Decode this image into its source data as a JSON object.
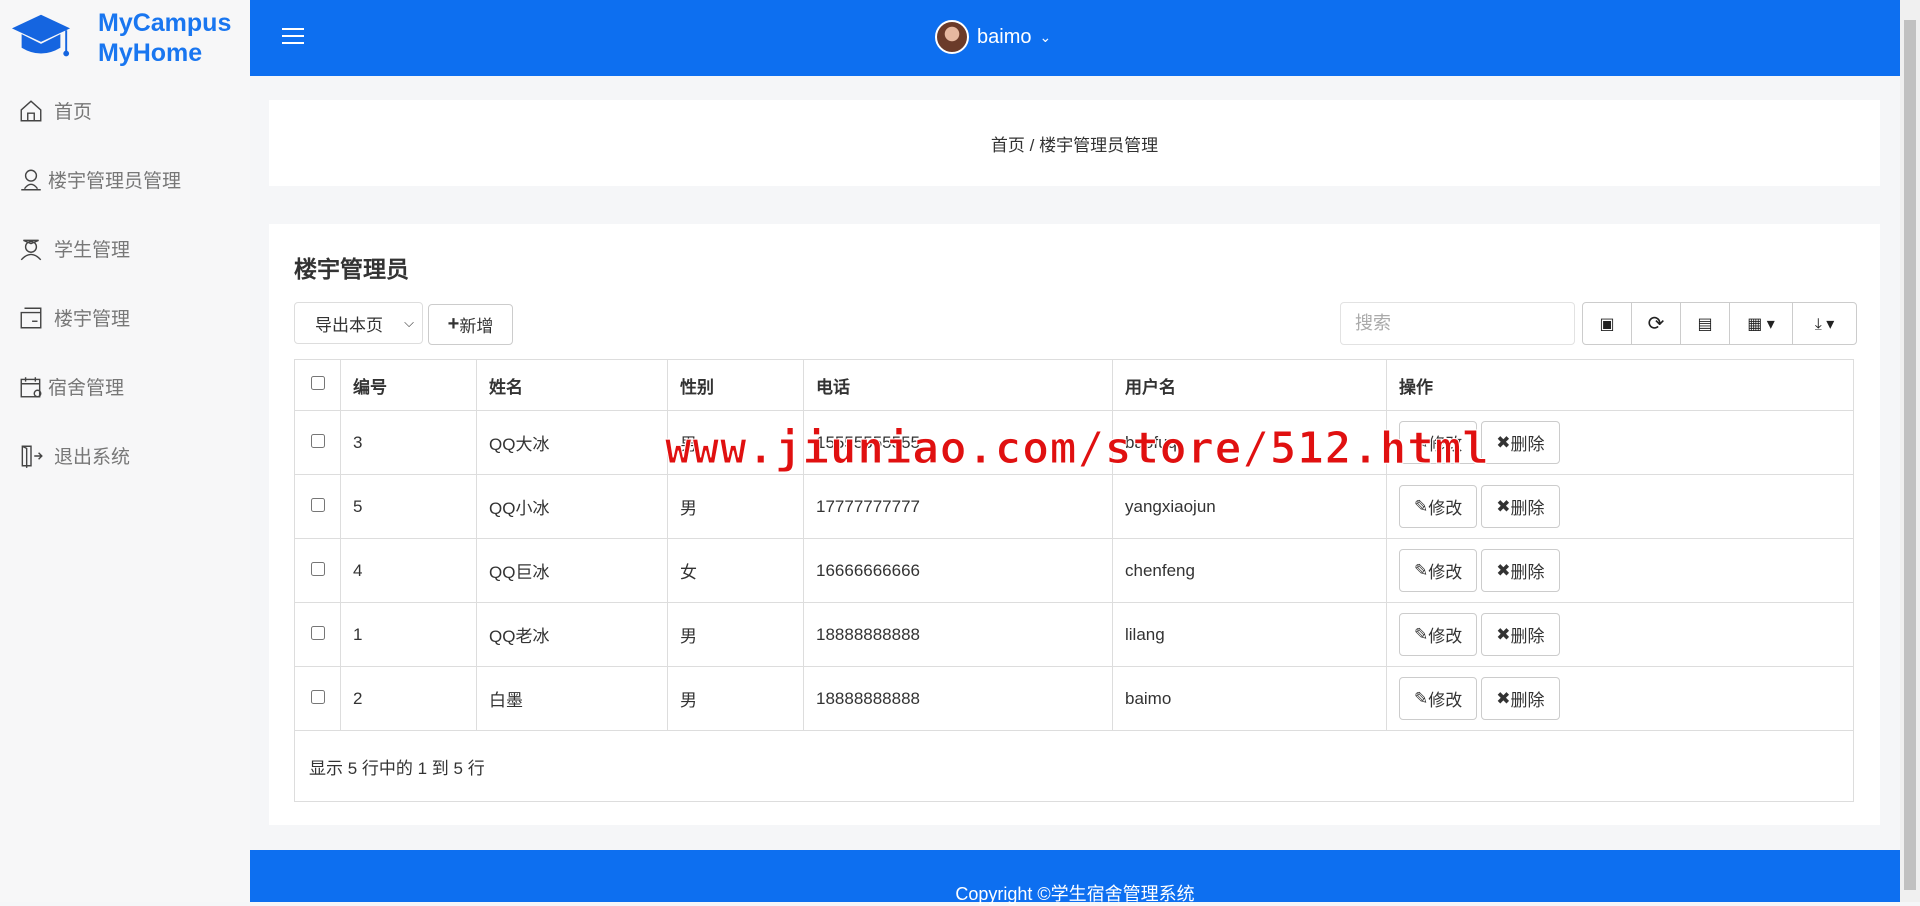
{
  "brand": {
    "line1": "MyCampus",
    "line2": "MyHome"
  },
  "sidebar": {
    "items": [
      {
        "label": "首页",
        "icon": "home-icon"
      },
      {
        "label": "楼宇管理员管理",
        "icon": "admin-icon"
      },
      {
        "label": "学生管理",
        "icon": "student-icon"
      },
      {
        "label": "楼宇管理",
        "icon": "folder-icon"
      },
      {
        "label": "宿舍管理",
        "icon": "calendar-icon"
      },
      {
        "label": "退出系统",
        "icon": "logout-icon"
      }
    ]
  },
  "header": {
    "username": "baimo"
  },
  "breadcrumb": "首页 / 楼宇管理员管理",
  "main": {
    "title": "楼宇管理员",
    "export_select": "导出本页",
    "add_label": "新增",
    "search_placeholder": "搜索"
  },
  "table": {
    "headers": [
      "编号",
      "姓名",
      "性别",
      "电话",
      "用户名",
      "操作"
    ],
    "rows": [
      [
        "3",
        "QQ大冰",
        "男",
        "15555555555",
        "baofuq"
      ],
      [
        "5",
        "QQ小冰",
        "男",
        "17777777777",
        "yangxiaojun"
      ],
      [
        "4",
        "QQ巨冰",
        "女",
        "16666666666",
        "chenfeng"
      ],
      [
        "1",
        "QQ老冰",
        "男",
        "18888888888",
        "lilang"
      ],
      [
        "2",
        "白墨",
        "男",
        "18888888888",
        "baimo"
      ]
    ],
    "edit_label": "修改",
    "delete_label": "删除",
    "summary": "显示 5 行中的 1 到 5 行"
  },
  "footer": "Copyright ©学生宿舍管理系统",
  "watermark": "www.jiuniao.com/store/512.html"
}
